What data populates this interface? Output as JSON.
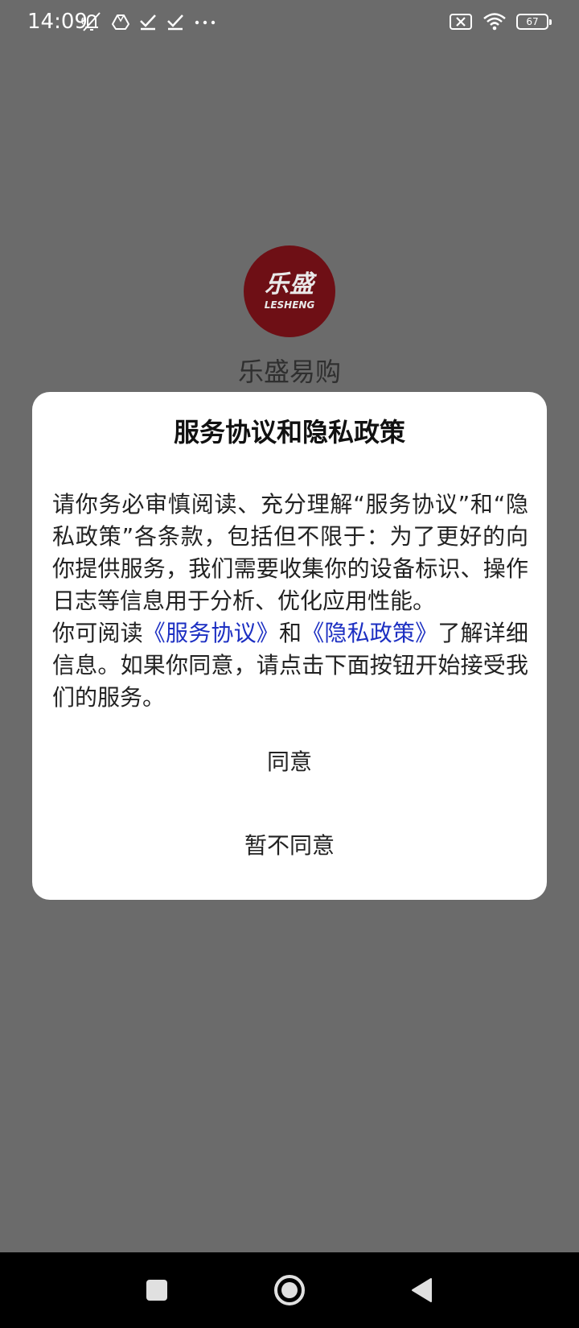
{
  "status_bar": {
    "time": "14:09",
    "left_icons": [
      "muted-bell-icon",
      "drive-icon",
      "check-icon",
      "check-icon",
      "more-dots-icon"
    ],
    "right_icons": [
      "no-sim-icon",
      "wifi-icon",
      "battery-icon"
    ],
    "battery_level": "67"
  },
  "splash": {
    "logo_text_cn": "乐盛",
    "logo_text_en": "LESHENG",
    "app_name": "乐盛易购",
    "logo_color": "#6e0f15"
  },
  "dialog": {
    "title": "服务协议和隐私政策",
    "paragraph1": "请你务必审慎阅读、充分理解“服务协议”和“隐私政策”各条款，包括但不限于：为了更好的向你提供服务，我们需要收集你的设备标识、操作日志等信息用于分析、优化应用性能。",
    "p2_prefix": "你可阅读",
    "service_link": "《服务协议》",
    "p2_and": "和",
    "privacy_link": "《隐私政策》",
    "p2_suffix": "了解详细信息。如果你同意，请点击下面按钮开始接受我们的服务。",
    "agree_label": "同意",
    "disagree_label": "暂不同意",
    "link_color": "#1c2fc2"
  },
  "nav_bar": {
    "buttons": [
      "recents-square-icon",
      "home-circle-icon",
      "back-triangle-icon"
    ]
  }
}
